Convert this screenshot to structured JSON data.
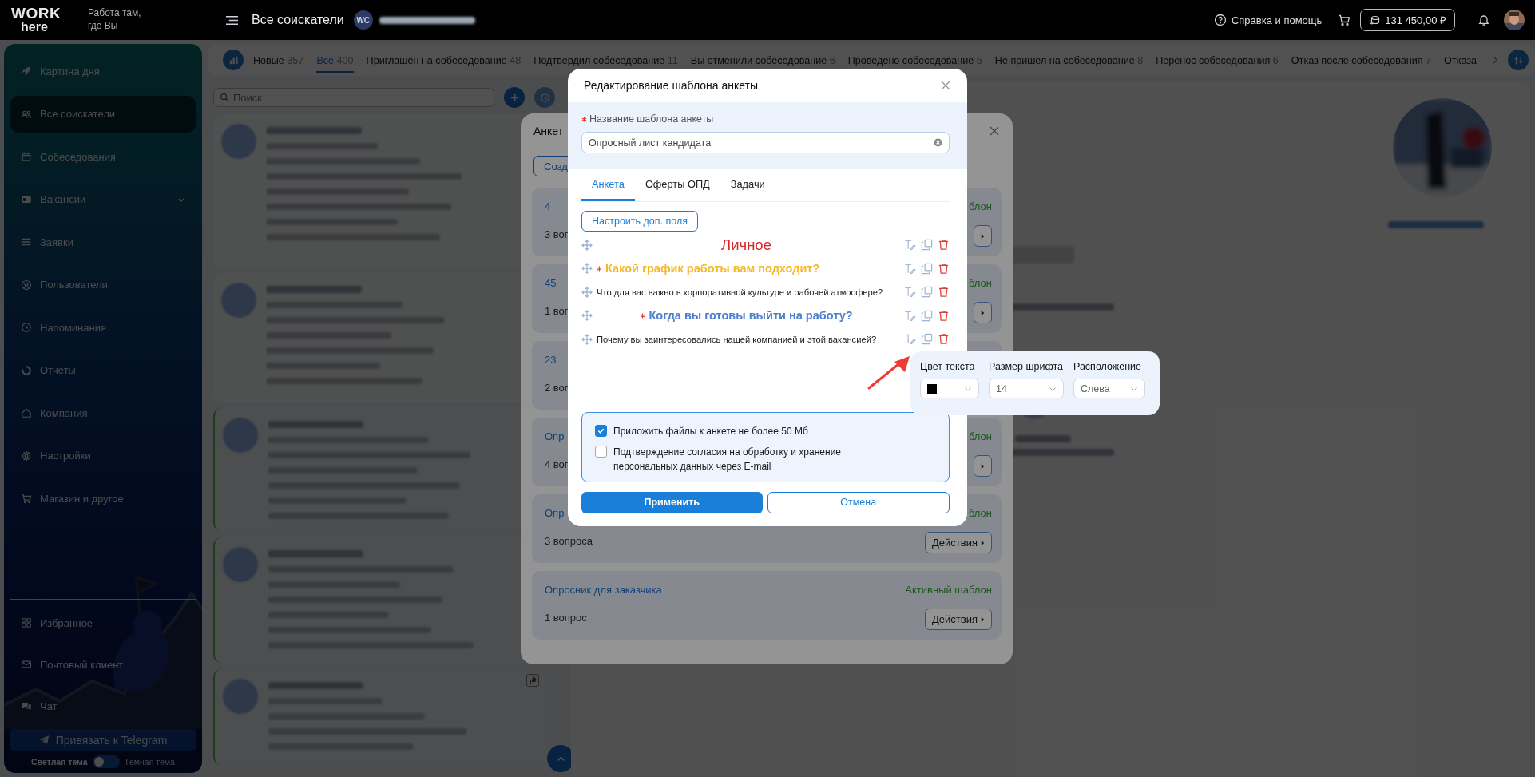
{
  "top_bar": {
    "logo_top": "WORK",
    "logo_bottom": "here",
    "tagline": "Работа там, где Вы",
    "page_title": "Все соискатели",
    "account_initials": "WC",
    "help": "Справка и помощь",
    "balance": "131 450,00 ₽"
  },
  "sidebar": {
    "items": [
      {
        "label": "Картина дня",
        "selected": false,
        "expandable": false
      },
      {
        "label": "Все соискатели",
        "selected": true,
        "expandable": false
      },
      {
        "label": "Собеседования",
        "selected": false,
        "expandable": false
      },
      {
        "label": "Вакансии",
        "selected": false,
        "expandable": true
      },
      {
        "label": "Заявки",
        "selected": false,
        "expandable": false
      },
      {
        "label": "Пользователи",
        "selected": false,
        "expandable": false
      },
      {
        "label": "Напоминания",
        "selected": false,
        "expandable": false
      },
      {
        "label": "Отчеты",
        "selected": false,
        "expandable": false
      },
      {
        "label": "Компания",
        "selected": false,
        "expandable": false
      },
      {
        "label": "Настройки",
        "selected": false,
        "expandable": false
      },
      {
        "label": "Магазин и другое",
        "selected": false,
        "expandable": false
      }
    ],
    "bottom_items": [
      {
        "label": "Избранное",
        "selected": false
      },
      {
        "label": "Почтовый клиент",
        "selected": false
      },
      {
        "label": "Чат",
        "selected": false
      }
    ],
    "telegram_button": "Привязать к Telegram",
    "theme": {
      "light_label": "Светлая тема",
      "dark_label": "Тёмная тема",
      "dark": false
    }
  },
  "status_tabs": [
    {
      "label": "Новые",
      "count": "357",
      "selected": false
    },
    {
      "label": "Все",
      "count": "400",
      "selected": true
    },
    {
      "label": "Приглашён на собеседование",
      "count": "48",
      "selected": false
    },
    {
      "label": "Подтвердил собеседование",
      "count": "11",
      "selected": false
    },
    {
      "label": "Вы отменили собеседование",
      "count": "6",
      "selected": false
    },
    {
      "label": "Проведено собеседование",
      "count": "5",
      "selected": false
    },
    {
      "label": "Не пришел на собеседование",
      "count": "8",
      "selected": false
    },
    {
      "label": "Перенос собеседования",
      "count": "6",
      "selected": false
    },
    {
      "label": "Отказ после собеседования",
      "count": "7",
      "selected": false
    },
    {
      "label": "Отказа",
      "selected": false
    }
  ],
  "search": {
    "placeholder": "Поиск"
  },
  "templates_dialog": {
    "title": "Анкет",
    "create_button": "Созд",
    "cards": [
      {
        "title": "4",
        "questions": "3 воп",
        "status": "блон",
        "button": true
      },
      {
        "title": "45",
        "questions": "1 воп",
        "status": "блон",
        "button": true
      },
      {
        "title": "23",
        "questions": "2 воп",
        "button": false
      },
      {
        "title": "Опр",
        "questions": "4 воп",
        "status": "блон",
        "button": true
      },
      {
        "title": "Опр",
        "questions": "3 вопроса",
        "status": "блон",
        "button": true,
        "button_label": "Действия"
      },
      {
        "title": "Опросник для заказчика",
        "questions": "1 вопрос",
        "status": "Активный шаблон",
        "button": true,
        "button_label": "Действия"
      }
    ]
  },
  "edit_dialog": {
    "title": "Редактирование шаблона анкеты",
    "name_label": "Название шаблона анкеты",
    "name_required": true,
    "name_value": "Опросный лист кандидата",
    "tabs": [
      {
        "label": "Анкета",
        "selected": true
      },
      {
        "label": "Оферты ОПД",
        "selected": false
      },
      {
        "label": "Задачи",
        "selected": false
      }
    ],
    "fields_button": "Настроить доп. поля",
    "questions": [
      {
        "text": "Личное",
        "kind": "title",
        "required": false,
        "color": "#d8262b",
        "centered": true
      },
      {
        "text": "Какой график работы вам подходит?",
        "kind": "highlight",
        "required": true,
        "color": "#f4b92c",
        "centered": false
      },
      {
        "text": "Что для вас важно в корпоративной культуре и рабочей атмосфере?",
        "kind": "plain",
        "required": false,
        "color": "#1c1c1c",
        "centered": false
      },
      {
        "text": "Когда вы готовы выйти на работу?",
        "kind": "highlight",
        "required": true,
        "color": "#4b7fd0",
        "centered": true
      },
      {
        "text": "Почему вы заинтересовались нашей компанией и этой вакансией?",
        "kind": "plain",
        "required": false,
        "color": "#1c1c1c",
        "centered": false
      }
    ],
    "options": [
      {
        "label": "Приложить файлы к анкете не более 50 Мб",
        "checked": true
      },
      {
        "label": "Подтверждение согласия на обработку и хранение персональных данных через E-mail",
        "checked": false
      }
    ],
    "apply_button": "Применить",
    "cancel_button": "Отмена"
  },
  "format_popover": {
    "fields": [
      {
        "label": "Цвет текста",
        "kind": "color",
        "color": "#000000"
      },
      {
        "label": "Размер шрифта",
        "kind": "text",
        "value": "14"
      },
      {
        "label": "Расположение",
        "kind": "text",
        "value": "Слева"
      }
    ]
  }
}
